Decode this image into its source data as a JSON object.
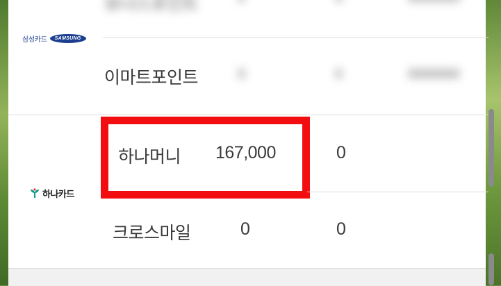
{
  "cards": [
    {
      "brand_logo": {
        "korean": "삼성카드",
        "english": "SAMSUNG"
      },
      "rows": [
        {
          "name": "보너스포인트",
          "value1": "0",
          "value2": "0",
          "value3": "0000000",
          "blurred": true
        },
        {
          "name": "이마트포인트",
          "value1": "0",
          "value2": "0",
          "value3": "0000000",
          "blurred": true
        }
      ]
    },
    {
      "brand_logo": {
        "korean": "하나카드",
        "icon": "hana-leaf-icon"
      },
      "rows": [
        {
          "name": "하나머니",
          "value1": "167,000",
          "value2": "0",
          "highlighted": true
        },
        {
          "name": "크로스마일",
          "value1": "0",
          "value2": "0"
        }
      ]
    }
  ],
  "colors": {
    "highlight": "#f20d10",
    "samsung_blue": "#1c3f8f",
    "hana_green": "#0d9a8a",
    "hana_red": "#e53935"
  }
}
